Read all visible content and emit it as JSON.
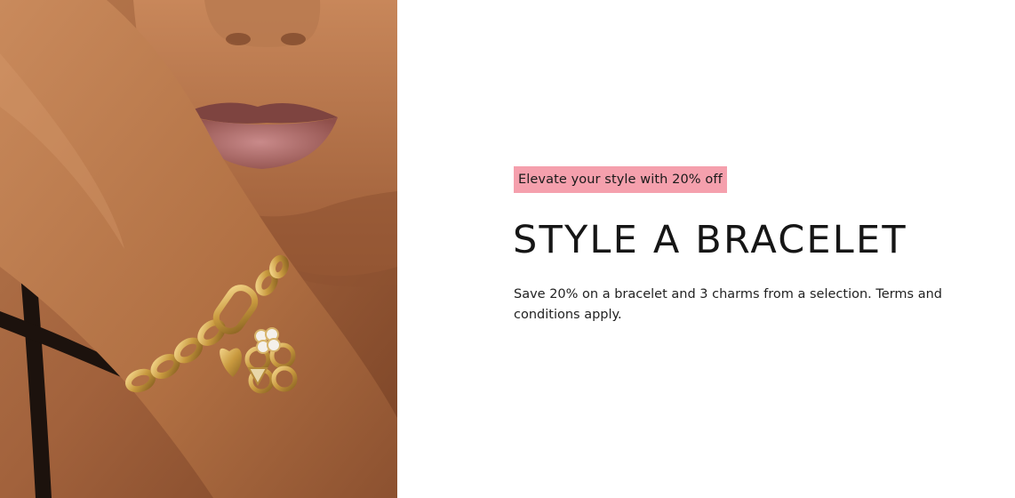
{
  "hero": {
    "image_alt": "Close-up of a woman's face resting on her wrist, wearing a gold chain bracelet with heart, clover and guitar-pick charms"
  },
  "promo": {
    "badge_text": "Elevate your style with 20% off",
    "badge_color": "#f5a0ad"
  },
  "headline": "STYLE A BRACELET",
  "description": "Save 20% on a bracelet and 3 charms from a selection. Terms and conditions apply."
}
